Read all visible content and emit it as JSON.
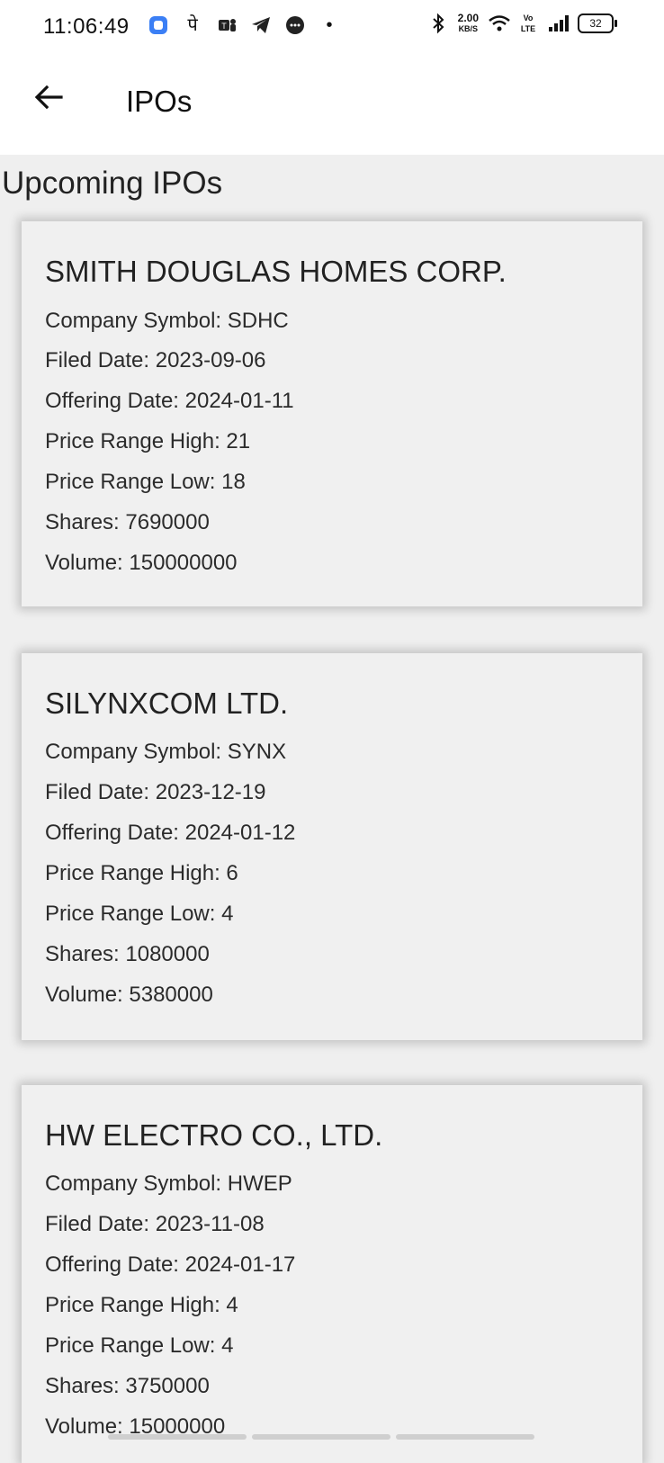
{
  "status_bar": {
    "time": "11:06:49",
    "net_speed_value": "2.00",
    "net_speed_unit": "KB/S",
    "volte": "Vo LTE",
    "battery": "32"
  },
  "app_bar": {
    "title": "IPOs",
    "back_icon": "arrow-left-icon"
  },
  "section": {
    "title": "Upcoming IPOs"
  },
  "ipos": [
    {
      "name": "SMITH DOUGLAS HOMES CORP.",
      "symbol": "Company Symbol: SDHC",
      "filed": "Filed Date: 2023-09-06",
      "offering": "Offering Date: 2024-01-11",
      "high": "Price Range High: 21",
      "low": "Price Range Low: 18",
      "shares": "Shares: 7690000",
      "volume": "Volume: 150000000"
    },
    {
      "name": "SILYNXCOM LTD.",
      "symbol": "Company Symbol: SYNX",
      "filed": "Filed Date: 2023-12-19",
      "offering": "Offering Date: 2024-01-12",
      "high": "Price Range High: 6",
      "low": "Price Range Low: 4",
      "shares": "Shares: 1080000",
      "volume": "Volume: 5380000"
    },
    {
      "name": "HW ELECTRO CO., LTD.",
      "symbol": "Company Symbol: HWEP",
      "filed": "Filed Date: 2023-11-08",
      "offering": "Offering Date: 2024-01-17",
      "high": "Price Range High: 4",
      "low": "Price Range Low: 4",
      "shares": "Shares: 3750000",
      "volume": "Volume: 15000000"
    }
  ]
}
